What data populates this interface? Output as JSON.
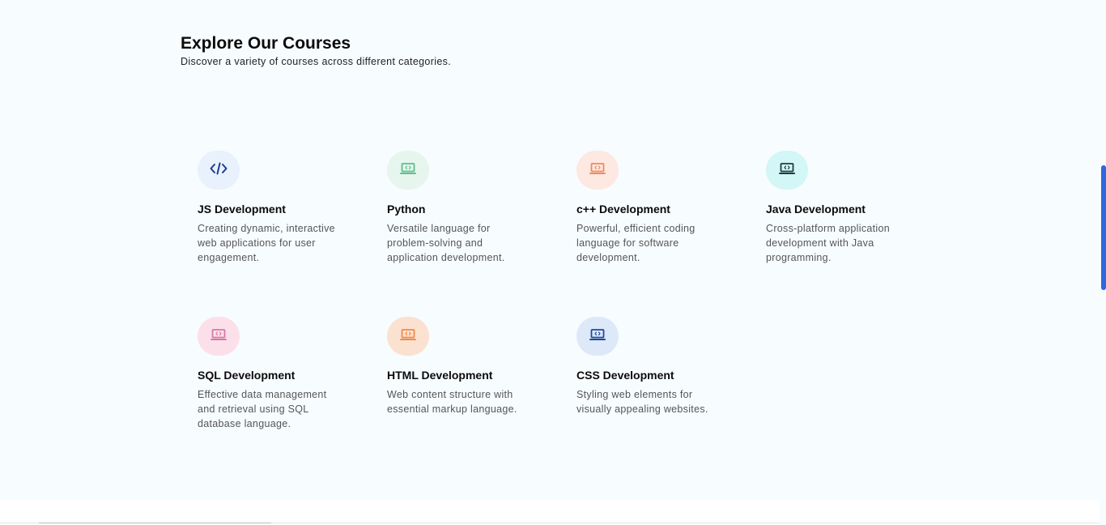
{
  "header": {
    "title": "Explore Our Courses",
    "subtitle": "Discover a variety of courses across different categories."
  },
  "courses": [
    {
      "title": "JS Development",
      "description": "Creating dynamic, interactive web applications for user engagement.",
      "icon": "code-brackets-icon",
      "icon_color": "#1b3f8f",
      "bg_color": "#e9f1fc"
    },
    {
      "title": "Python",
      "description": "Versatile language for problem-solving and application development.",
      "icon": "laptop-code-icon",
      "icon_color": "#5cbf8f",
      "bg_color": "#e6f6ee"
    },
    {
      "title": "c++ Development",
      "description": "Powerful, efficient coding language for software development.",
      "icon": "laptop-code-icon",
      "icon_color": "#f08a5d",
      "bg_color": "#fde8e2"
    },
    {
      "title": "Java Development",
      "description": "Cross-platform application development with Java programming.",
      "icon": "laptop-code-icon",
      "icon_color": "#1f3b44",
      "bg_color": "#d3f6f6"
    },
    {
      "title": "SQL Development",
      "description": "Effective data management and retrieval using SQL database language.",
      "icon": "laptop-code-icon",
      "icon_color": "#d779a6",
      "bg_color": "#fbe0ea"
    },
    {
      "title": "HTML Development",
      "description": "Web content structure with essential markup language.",
      "icon": "laptop-code-icon",
      "icon_color": "#f08a4b",
      "bg_color": "#fbe1cf"
    },
    {
      "title": "CSS Development",
      "description": "Styling web elements for visually appealing websites.",
      "icon": "laptop-code-icon",
      "icon_color": "#1e4a9f",
      "bg_color": "#dde8f8"
    }
  ],
  "colors": {
    "section_bg": "#f7fcfe",
    "scrollbar_thumb": "#2f67dd"
  }
}
